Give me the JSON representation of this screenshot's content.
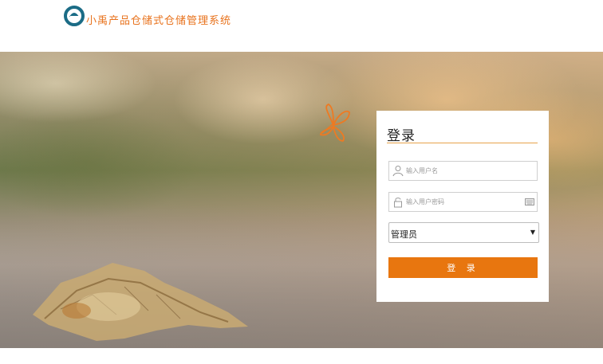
{
  "header": {
    "app_title": "小禹产品仓储式仓储管理系统"
  },
  "login": {
    "title": "登录",
    "username_placeholder": "输入用户名",
    "password_placeholder": "输入用户密码",
    "role_selected": "管理员",
    "submit_label": "登 录"
  },
  "colors": {
    "accent": "#e8760f",
    "logo_blue": "#1b6c86",
    "title_rule": "#e8a34b"
  },
  "icons": {
    "logo": "logo-icon",
    "username": "user-icon",
    "password": "lock-icon",
    "keyboard": "keyboard-icon",
    "role_caret": "caret-down-icon",
    "decoration": "butterfly-icon"
  }
}
